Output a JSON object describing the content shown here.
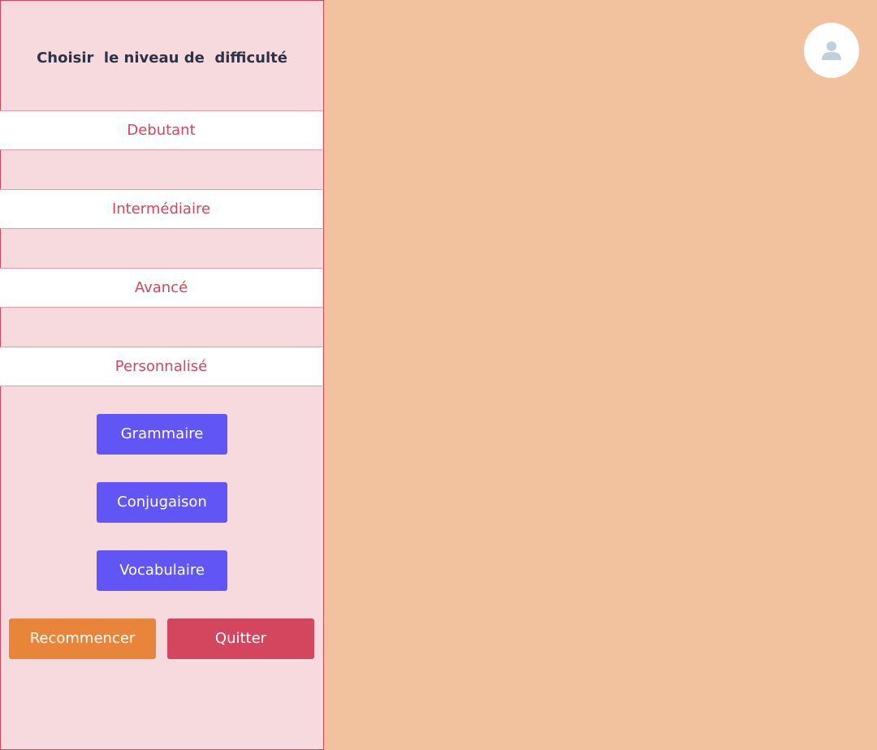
{
  "sidebar": {
    "title": "Choisir  le niveau de  difficulté",
    "levels": [
      {
        "label": "Debutant"
      },
      {
        "label": "Intermédiaire"
      },
      {
        "label": "Avancé"
      },
      {
        "label": "Personnalisé"
      }
    ],
    "topics": [
      {
        "label": "Grammaire"
      },
      {
        "label": "Conjugaison"
      },
      {
        "label": "Vocabulaire"
      }
    ],
    "actions": {
      "restart_label": "Recommencer",
      "quit_label": "Quitter"
    }
  },
  "header": {
    "avatar_icon": "user-icon"
  },
  "colors": {
    "background": "#f2c29e",
    "sidebar_bg": "#f7dade",
    "accent_red": "#d4465e",
    "topic_purple": "#6155f5",
    "restart_orange": "#e8853b",
    "title_text": "#2d3347"
  }
}
